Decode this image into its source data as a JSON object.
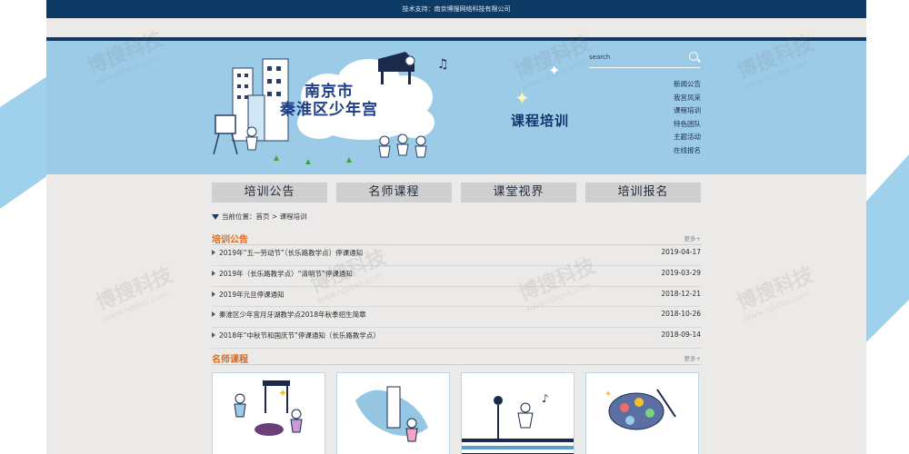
{
  "footer": {
    "tech_support": "技术支持：南京博搜网络科技有限公司"
  },
  "banner": {
    "logo_line1": "南京市",
    "logo_line2": "秦淮区少年宫",
    "heading": "课程培训",
    "search_placeholder": "search",
    "side_links": [
      "新闻公告",
      "我宫风采",
      "课程培训",
      "特色团队",
      "主题活动",
      "在线报名"
    ]
  },
  "nav": {
    "tabs": [
      "培训公告",
      "名师课程",
      "课堂视界",
      "培训报名"
    ]
  },
  "breadcrumb": {
    "prefix": "当前位置：",
    "home": "首页",
    "sep": ">",
    "current": "课程培训"
  },
  "announcements": {
    "title": "培训公告",
    "more": "更多+",
    "items": [
      {
        "title": "2019年“五一劳动节”（长乐路教学点）停课通知",
        "date": "2019-04-17"
      },
      {
        "title": "2019年（长乐路教学点）“清明节”停课通知",
        "date": "2019-03-29"
      },
      {
        "title": "2019年元旦停课通知",
        "date": "2018-12-21"
      },
      {
        "title": "秦淮区少年宫月牙湖教学点2018年秋季招生简章",
        "date": "2018-10-26"
      },
      {
        "title": "2018年“中秋节和国庆节”停课通知（长乐路教学点）",
        "date": "2018-09-14"
      }
    ]
  },
  "courses": {
    "title": "名师课程",
    "more": "更多+"
  },
  "watermark": {
    "brand": "博搜科技",
    "url": "www.njboso.com"
  },
  "colors": {
    "navy": "#0e3a66",
    "banner": "#9ccbe8",
    "accent": "#e06a1a",
    "tab": "#cfcfcf"
  }
}
